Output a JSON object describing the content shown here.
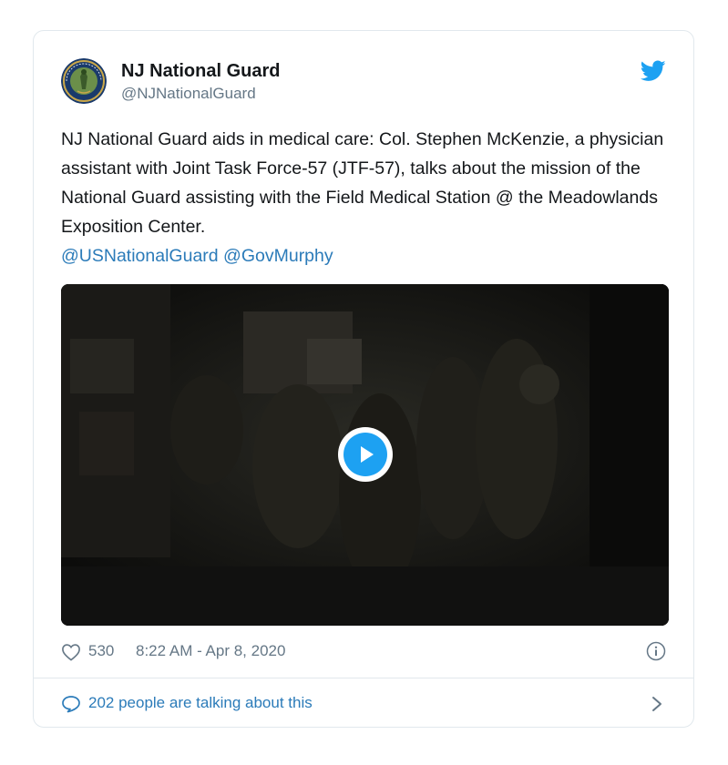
{
  "account": {
    "name": "NJ National Guard",
    "handle": "@NJNationalGuard",
    "avatar_icon": "nj-national-guard-seal-icon",
    "logo_icon": "twitter-bird-icon"
  },
  "tweet": {
    "text": "NJ National Guard aids in medical care: Col. Stephen McKenzie, a physician assistant with Joint Task Force-57 (JTF-57), talks about the mission of the National Guard assisting with the Field Medical Station @ the Meadowlands Exposition Center.",
    "mentions": [
      "@USNationalGuard",
      "@GovMurphy"
    ]
  },
  "media": {
    "type": "video",
    "play_icon": "play-icon"
  },
  "meta": {
    "likes": "530",
    "timestamp": "8:22 AM - Apr 8, 2020",
    "like_icon": "heart-icon",
    "info_icon": "info-icon"
  },
  "footer": {
    "conversation_text": "202 people are talking about this",
    "conversation_icon": "speech-bubble-icon",
    "chevron_icon": "chevron-right-icon"
  },
  "colors": {
    "link": "#2b7bb9",
    "twitter_blue": "#1da1f2",
    "text": "#14171a",
    "muted": "#657786",
    "border": "#e1e8ed"
  }
}
